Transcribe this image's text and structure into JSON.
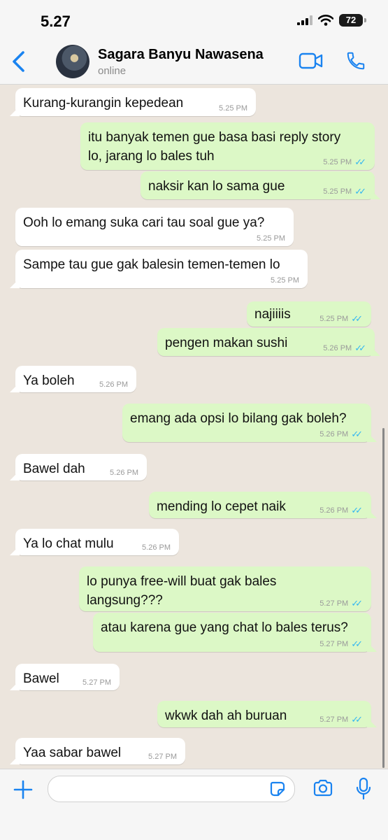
{
  "status_bar": {
    "time": "5.27",
    "battery": "72"
  },
  "header": {
    "back_icon": "chevron-left-icon",
    "contact_name": "Sagara Banyu Nawasena",
    "contact_status": "online",
    "video_icon": "video-call-icon",
    "phone_icon": "phone-icon"
  },
  "colors": {
    "accent": "#1a83f0",
    "outgoing_bubble": "#dcf8c6",
    "incoming_bubble": "#ffffff",
    "chat_background": "#ece5dd",
    "read_ticks": "#34b7f1"
  },
  "messages": [
    {
      "direction": "in",
      "lines": [
        "Kurang-kurangin kepedean"
      ],
      "time": "5.25 PM"
    },
    {
      "direction": "out",
      "lines": [
        "itu banyak temen gue basa basi reply story",
        "lo, jarang lo bales tuh"
      ],
      "time": "5.25 PM",
      "ticks": "✓✓"
    },
    {
      "direction": "out",
      "lines": [
        "naksir kan lo sama gue"
      ],
      "time": "5.25 PM",
      "ticks": "✓✓"
    },
    {
      "direction": "in",
      "lines": [
        "Ooh lo emang suka cari tau soal gue ya?"
      ],
      "time": "5.25 PM"
    },
    {
      "direction": "in",
      "lines": [
        "Sampe tau gue gak balesin temen-temen lo"
      ],
      "time": "5.25 PM"
    },
    {
      "direction": "out",
      "lines": [
        "najiiiis"
      ],
      "time": "5.25 PM",
      "ticks": "✓✓"
    },
    {
      "direction": "out",
      "lines": [
        "pengen makan sushi"
      ],
      "time": "5.26 PM",
      "ticks": "✓✓"
    },
    {
      "direction": "in",
      "lines": [
        "Ya boleh"
      ],
      "time": "5.26 PM"
    },
    {
      "direction": "out",
      "lines": [
        "emang ada opsi lo bilang gak boleh?"
      ],
      "time": "5.26 PM",
      "ticks": "✓✓"
    },
    {
      "direction": "in",
      "lines": [
        "Bawel dah"
      ],
      "time": "5.26 PM"
    },
    {
      "direction": "out",
      "lines": [
        "mending lo cepet naik"
      ],
      "time": "5.26 PM",
      "ticks": "✓✓"
    },
    {
      "direction": "in",
      "lines": [
        "Ya lo chat mulu"
      ],
      "time": "5.26 PM"
    },
    {
      "direction": "out",
      "lines": [
        "lo punya free-will buat gak bales",
        "langsung???"
      ],
      "time": "5.27 PM",
      "ticks": "✓✓"
    },
    {
      "direction": "out",
      "lines": [
        "atau karena gue yang chat lo bales terus?"
      ],
      "time": "5.27 PM",
      "ticks": "✓✓"
    },
    {
      "direction": "in",
      "lines": [
        "Bawel"
      ],
      "time": "5.27 PM"
    },
    {
      "direction": "out",
      "lines": [
        "wkwk dah ah buruan"
      ],
      "time": "5.27 PM",
      "ticks": "✓✓"
    },
    {
      "direction": "in",
      "lines": [
        "Yaa sabar bawel"
      ],
      "time": "5.27 PM"
    }
  ],
  "input_bar": {
    "plus_icon": "plus-icon",
    "sticker_icon": "sticker-icon",
    "camera_icon": "camera-icon",
    "mic_icon": "microphone-icon"
  }
}
